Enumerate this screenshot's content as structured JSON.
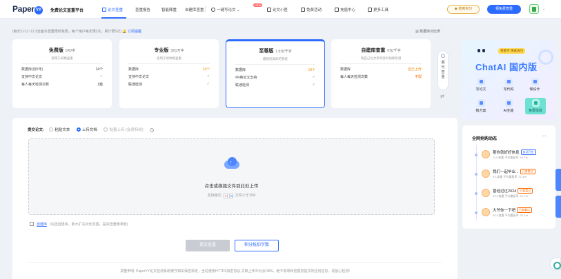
{
  "header": {
    "logo": "Paper",
    "logo_mark": "YY",
    "subtitle": "免费论文查重平台",
    "nav": [
      {
        "label": "论文查重",
        "active": true
      },
      {
        "label": "查重报告"
      },
      {
        "label": "智能降重"
      },
      {
        "label": "自建库查重"
      },
      {
        "label": "一键写论文"
      },
      {
        "label": "论文小匠"
      },
      {
        "label": "免费活动"
      },
      {
        "label": "充值中心"
      },
      {
        "label": "更多工具"
      }
    ],
    "new_badge": "NEW",
    "checkin_button": "签到积分",
    "free_button": "领免费查重"
  },
  "notice": {
    "text": "(每天11:11~11:2全面本查重限时免费，每个用户每天限2次，累计限5次)",
    "link": "订阅提醒",
    "stats_link": "数据库对比表"
  },
  "cards": [
    {
      "name": "免费版",
      "price": "0元/字",
      "desc": "适用于初稿查重",
      "rows": [
        [
          "数据库(近5年)",
          "14个"
        ],
        [
          "支持中文论文",
          "✓"
        ],
        [
          "每人每天检测次数",
          "1篇"
        ]
      ]
    },
    {
      "name": "专业版",
      "price": "3元/万字",
      "desc": "适用于修改稿查重",
      "rows": [
        [
          "数据库",
          "14个"
        ],
        [
          "支持中文论文",
          "✓"
        ],
        [
          "联通检测",
          "✓"
        ]
      ]
    },
    {
      "name": "至尊版",
      "price": "1.5元/千字",
      "desc": "最接近高校的系统",
      "rows": [
        [
          "数据库",
          "18个"
        ],
        [
          "中/英论文支持",
          "✓"
        ],
        [
          "联通检测",
          "✓"
        ]
      ]
    },
    {
      "name": "自建库查重",
      "price": "0元/千字",
      "desc": "将自己论文参考资料加库检测",
      "rows": [
        [
          "数据库",
          "自己上传"
        ],
        [
          "每人每天检测次数",
          "不限"
        ]
      ]
    }
  ],
  "side_tab": "期刊查重",
  "promo": {
    "tag": "青椒子 快速访问",
    "title": "ChatAI 国内版",
    "tools": [
      "写论文",
      "写代码",
      "做设计",
      "搞方案",
      "AI全能",
      "免费体验"
    ]
  },
  "upload": {
    "label": "提交论文:",
    "options": [
      "粘贴文本",
      "上传文档",
      "批量上传 (会员特权)"
    ],
    "drop_title": "点击或拖拽文件到此处上传",
    "drop_support_prefix": "支持格式:",
    "drop_support_suffix": "文件小于15M",
    "format_icons": [
      "pdf-icon",
      "word-icon"
    ],
    "selflib_link": "自建库",
    "selflib_desc": "(勾选自建库，即大扩充对比范围，提高查重精准度)",
    "submit": "提交查重",
    "points": "积分抵扣字数",
    "footer": "郑重申明: PaperYY论文检测系统遵守相关保密规定，全站使用HTTPS加密协议,文稿上传华为云OBS，绝不收录和泄露您提交的任何信息，请放心检测!"
  },
  "activity": {
    "title": "全网抢购动态",
    "pager": "‹ ›",
    "items": [
      {
        "name": "那你就好好休息",
        "badge": "自动已检",
        "meta": "11人查重  平均重复率: 18.7%"
      },
      {
        "name": "我们一起毕业...",
        "badge": "已查看过",
        "meta": "9人查重  平均重复率: 21.4%"
      },
      {
        "name": "曾经过过2024",
        "badge": "已查看过",
        "meta": "13人查重  平均重复率: 11.7%"
      },
      {
        "name": "大爷你一下吧",
        "badge": "已查看过",
        "meta": "20人查重  平均重复率: 22.1%"
      }
    ]
  },
  "colors": {
    "accent": "#2d6bff",
    "orange": "#f08c00",
    "teal": "#6ee1d2"
  }
}
